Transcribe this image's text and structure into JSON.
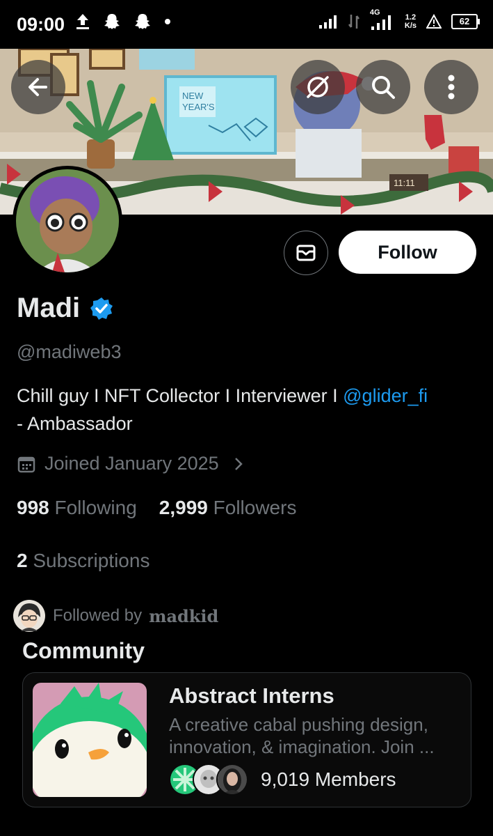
{
  "status_bar": {
    "time": "09:00",
    "network": "4G",
    "speed_value": "1.2",
    "speed_unit": "K/s",
    "battery": "62"
  },
  "banner": {
    "screen_text_line1": "NEW",
    "screen_text_line2": "YEAR'S",
    "clock_text": "11:11"
  },
  "actions": {
    "follow_label": "Follow"
  },
  "profile": {
    "name": "Madi",
    "handle": "@madiweb3",
    "bio_text": "Chill guy I NFT Collector I Interviewer I ",
    "bio_mention": "@glider_fi",
    "bio_suffix": "- Ambassador",
    "joined": "Joined January 2025"
  },
  "stats": {
    "following_count": "998",
    "following_label": "Following",
    "followers_count": "2,999",
    "followers_label": "Followers",
    "subscriptions_count": "2",
    "subscriptions_label": "Subscriptions"
  },
  "followed_by": {
    "prefix": "Followed by",
    "name": "madkid"
  },
  "community": {
    "heading": "Community",
    "title": "Abstract Interns",
    "description": "A creative cabal pushing design, innovation, & imagination. Join ...",
    "members": "9,019 Members"
  },
  "colors": {
    "accent": "#1d9bf0",
    "background": "#000000",
    "muted_text": "#71767b"
  }
}
